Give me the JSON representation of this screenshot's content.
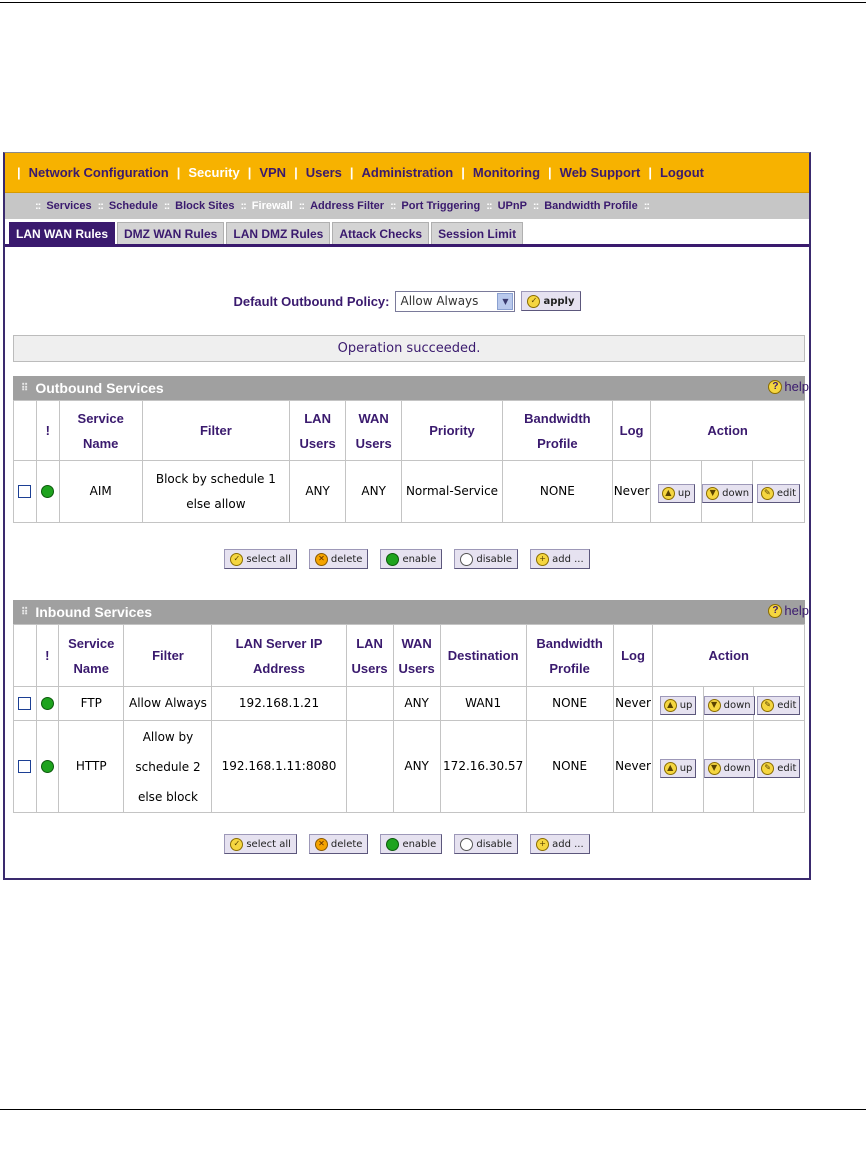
{
  "main_nav": [
    {
      "label": "Network Configuration",
      "active": false
    },
    {
      "label": "Security",
      "active": true
    },
    {
      "label": "VPN",
      "active": false
    },
    {
      "label": "Users",
      "active": false
    },
    {
      "label": "Administration",
      "active": false
    },
    {
      "label": "Monitoring",
      "active": false
    },
    {
      "label": "Web Support",
      "active": false
    },
    {
      "label": "Logout",
      "active": false
    }
  ],
  "sub_nav": [
    {
      "label": "Services",
      "active": false
    },
    {
      "label": "Schedule",
      "active": false
    },
    {
      "label": "Block Sites",
      "active": false
    },
    {
      "label": "Firewall",
      "active": true
    },
    {
      "label": "Address Filter",
      "active": false
    },
    {
      "label": "Port Triggering",
      "active": false
    },
    {
      "label": "UPnP",
      "active": false
    },
    {
      "label": "Bandwidth Profile",
      "active": false
    }
  ],
  "tabs": [
    {
      "label": "LAN WAN Rules",
      "active": true
    },
    {
      "label": "DMZ WAN Rules",
      "active": false
    },
    {
      "label": "LAN DMZ Rules",
      "active": false
    },
    {
      "label": "Attack Checks",
      "active": false
    },
    {
      "label": "Session Limit",
      "active": false
    }
  ],
  "policy": {
    "label": "Default Outbound Policy:",
    "value": "Allow Always",
    "apply_label": "apply"
  },
  "status_message": "Operation succeeded.",
  "help_label": "help",
  "outbound": {
    "title": "Outbound Services",
    "headers": {
      "bang": "!",
      "service_1": "Service",
      "service_2": "Name",
      "filter": "Filter",
      "lan_1": "LAN",
      "lan_2": "Users",
      "wan_1": "WAN",
      "wan_2": "Users",
      "priority": "Priority",
      "bw_1": "Bandwidth",
      "bw_2": "Profile",
      "log": "Log",
      "action": "Action"
    },
    "rows": [
      {
        "service": "AIM",
        "filter_1": "Block by schedule 1",
        "filter_2": "else allow",
        "lan_users": "ANY",
        "wan_users": "ANY",
        "priority": "Normal-Service",
        "bandwidth": "NONE",
        "log": "Never"
      }
    ]
  },
  "inbound": {
    "title": "Inbound Services",
    "headers": {
      "bang": "!",
      "service_1": "Service",
      "service_2": "Name",
      "filter": "Filter",
      "server_1": "LAN Server IP",
      "server_2": "Address",
      "lan_1": "LAN",
      "lan_2": "Users",
      "wan_1": "WAN",
      "wan_2": "Users",
      "destination": "Destination",
      "bw_1": "Bandwidth",
      "bw_2": "Profile",
      "log": "Log",
      "action": "Action"
    },
    "rows": [
      {
        "service": "FTP",
        "filter_1": "Allow Always",
        "filter_2": "",
        "filter_3": "",
        "server": "192.168.1.21",
        "lan_users": "",
        "wan_users": "ANY",
        "destination": "WAN1",
        "bandwidth": "NONE",
        "log": "Never"
      },
      {
        "service": "HTTP",
        "filter_1": "Allow by",
        "filter_2": "schedule 2",
        "filter_3": "else block",
        "server": "192.168.1.11:8080",
        "lan_users": "",
        "wan_users": "ANY",
        "destination": "172.16.30.57",
        "bandwidth": "NONE",
        "log": "Never"
      }
    ]
  },
  "row_actions": {
    "up": "up",
    "down": "down",
    "edit": "edit"
  },
  "bulk_actions": {
    "select_all": "select all",
    "delete": "delete",
    "enable": "enable",
    "disable": "disable",
    "add": "add ..."
  },
  "colors": {
    "nav_bg": "#f7b200",
    "accent": "#3a1a6e",
    "subnav_bg": "#c6c6c6",
    "status_ok": "#1ea31e"
  }
}
